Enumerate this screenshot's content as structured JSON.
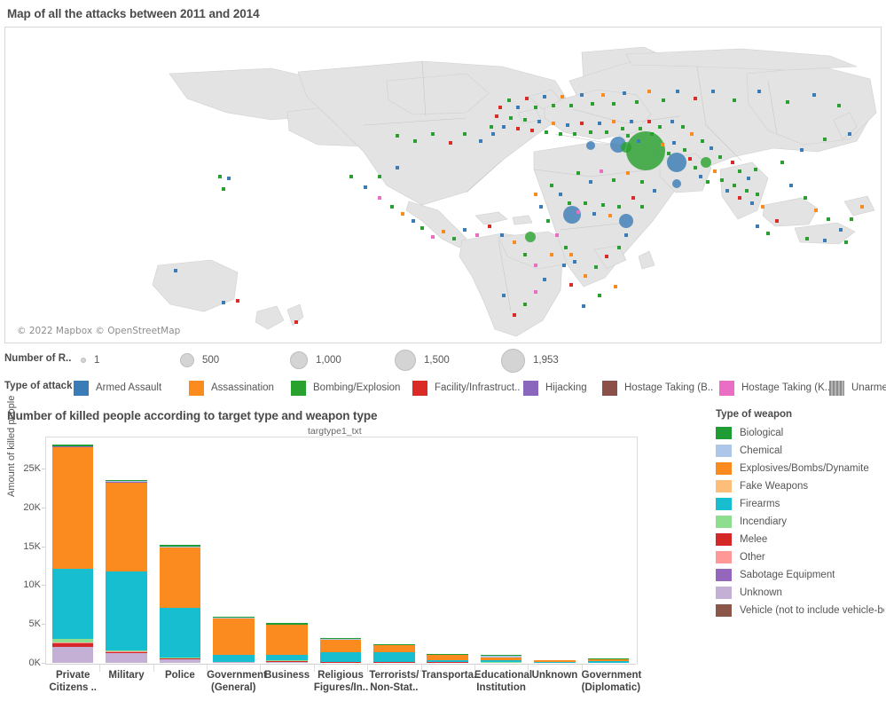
{
  "map_panel": {
    "title": "Map of all the attacks between 2011 and 2014",
    "attribution": "© 2022 Mapbox © OpenStreetMap"
  },
  "size_legend": {
    "caption": "Number of R..",
    "items": [
      {
        "label": "1",
        "diameter": 4
      },
      {
        "label": "500",
        "diameter": 14
      },
      {
        "label": "1,000",
        "diameter": 18
      },
      {
        "label": "1,500",
        "diameter": 22
      },
      {
        "label": "1,953",
        "diameter": 25
      }
    ]
  },
  "attack_legend": {
    "caption": "Type of attack",
    "items": [
      {
        "label": "Armed Assault",
        "color": "#3a7cb5"
      },
      {
        "label": "Assassination",
        "color": "#fb8b1e"
      },
      {
        "label": "Bombing/Explosion",
        "color": "#29a12e"
      },
      {
        "label": "Facility/Infrastruct..",
        "color": "#db2b27"
      },
      {
        "label": "Hijacking",
        "color": "#8b66bd"
      },
      {
        "label": "Hostage Taking (B..",
        "color": "#8a5049"
      },
      {
        "label": "Hostage Taking (K..",
        "color": "#ea6fc4"
      },
      {
        "label": "Unarme..",
        "color": "#909090",
        "hatched": true
      }
    ]
  },
  "bar_chart": {
    "title": "Number of killed people according to target type and weapon type",
    "field_label": "targtype1_txt"
  },
  "weapon_legend": {
    "title": "Type of weapon",
    "items": [
      {
        "label": "Biological",
        "color": "#1f9c34"
      },
      {
        "label": "Chemical",
        "color": "#aec7e8"
      },
      {
        "label": "Explosives/Bombs/Dynamite",
        "color": "#fb8b1e"
      },
      {
        "label": "Fake Weapons",
        "color": "#fcbe78"
      },
      {
        "label": "Firearms",
        "color": "#17becf"
      },
      {
        "label": "Incendiary",
        "color": "#8fde8f"
      },
      {
        "label": "Melee",
        "color": "#d62728"
      },
      {
        "label": "Other",
        "color": "#ff9896"
      },
      {
        "label": "Sabotage Equipment",
        "color": "#9467bd"
      },
      {
        "label": "Unknown",
        "color": "#c5b0d5"
      },
      {
        "label": "Vehicle (not to include vehicle-bo..",
        "color": "#8c564b"
      }
    ]
  },
  "chart_data": {
    "type": "bar",
    "stacked": true,
    "title": "Number of killed people according to target type and weapon type",
    "xlabel": "targtype1_txt",
    "ylabel": "Amount of killed people",
    "ylim": [
      0,
      29000
    ],
    "ytick_labels": [
      "0K",
      "5K",
      "10K",
      "15K",
      "20K",
      "25K"
    ],
    "ytick_values": [
      0,
      5000,
      10000,
      15000,
      20000,
      25000
    ],
    "grid": false,
    "legend_position": "right",
    "categories": [
      "Private Citizens ..",
      "Military",
      "Police",
      "Government (General)",
      "Business",
      "Religious Figures/In..",
      "Terrorists/ Non-Stat..",
      "Transporta..",
      "Educational Institution",
      "Unknown",
      "Government (Diplomatic)"
    ],
    "series": [
      {
        "name": "Unknown",
        "color": "#c5b0d5",
        "values": [
          2050,
          1250,
          500,
          60,
          130,
          40,
          30,
          40,
          30,
          0,
          20
        ]
      },
      {
        "name": "Melee",
        "color": "#d62728",
        "values": [
          520,
          160,
          70,
          40,
          60,
          60,
          40,
          20,
          20,
          0,
          10
        ]
      },
      {
        "name": "Other",
        "color": "#ff9896",
        "values": [
          60,
          30,
          20,
          10,
          10,
          10,
          5,
          5,
          5,
          0,
          5
        ]
      },
      {
        "name": "Incendiary",
        "color": "#8fde8f",
        "values": [
          420,
          120,
          70,
          40,
          90,
          40,
          20,
          30,
          30,
          0,
          10
        ]
      },
      {
        "name": "Fake Weapons",
        "color": "#fcbe78",
        "values": [
          40,
          20,
          10,
          5,
          10,
          5,
          5,
          5,
          5,
          0,
          5
        ]
      },
      {
        "name": "Firearms",
        "color": "#17becf",
        "values": [
          9050,
          10150,
          6400,
          900,
          720,
          1250,
          1300,
          280,
          210,
          60,
          150
        ]
      },
      {
        "name": "Explosives/Bombs/Dynamite",
        "color": "#fb8b1e",
        "values": [
          15650,
          11500,
          7800,
          4700,
          3900,
          1600,
          900,
          620,
          380,
          320,
          210
        ]
      },
      {
        "name": "Sabotage Equipment",
        "color": "#9467bd",
        "values": [
          20,
          10,
          5,
          5,
          5,
          5,
          5,
          5,
          5,
          0,
          5
        ]
      },
      {
        "name": "Chemical",
        "color": "#aec7e8",
        "values": [
          60,
          150,
          120,
          20,
          20,
          20,
          10,
          10,
          180,
          0,
          10
        ]
      },
      {
        "name": "Vehicle (not to include vehicle-bo..",
        "color": "#8c564b",
        "values": [
          30,
          20,
          10,
          10,
          10,
          5,
          5,
          5,
          5,
          0,
          5
        ]
      },
      {
        "name": "Biological",
        "color": "#1f9c34",
        "values": [
          100,
          20,
          10,
          110,
          20,
          10,
          5,
          5,
          5,
          0,
          5
        ]
      }
    ],
    "totals": [
      28000,
      23430,
      15015,
      5900,
      4975,
      3045,
      2320,
      1020,
      875,
      380,
      435
    ]
  }
}
